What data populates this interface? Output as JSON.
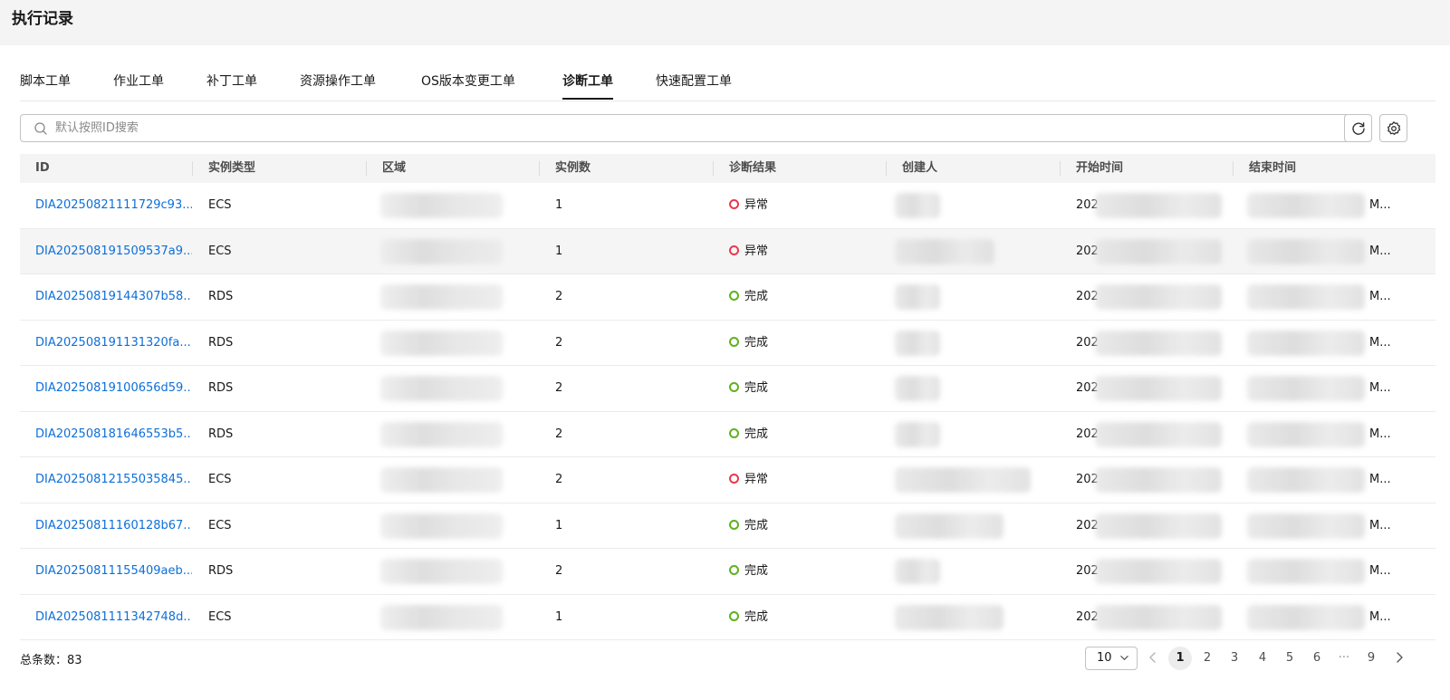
{
  "header": {
    "title": "执行记录"
  },
  "tabs": [
    {
      "label": "脚本工单"
    },
    {
      "label": "作业工单"
    },
    {
      "label": "补丁工单"
    },
    {
      "label": "资源操作工单"
    },
    {
      "label": "OS版本变更工单"
    },
    {
      "label": "诊断工单",
      "active": true
    },
    {
      "label": "快速配置工单"
    }
  ],
  "search": {
    "placeholder": "默认按照ID搜索",
    "value": ""
  },
  "table": {
    "columns": [
      "ID",
      "实例类型",
      "区域",
      "实例数",
      "诊断结果",
      "创建人",
      "开始时间",
      "结束时间"
    ],
    "rows": [
      {
        "id": "DIA20250821111729c93...",
        "type": "ECS",
        "count": "1",
        "result": "异常",
        "status": "error",
        "start": "202",
        "end": "M..."
      },
      {
        "id": "DIA202508191509537a9...",
        "type": "ECS",
        "count": "1",
        "result": "异常",
        "status": "error",
        "start": "202",
        "end": "M..."
      },
      {
        "id": "DIA20250819144307b58...",
        "type": "RDS",
        "count": "2",
        "result": "完成",
        "status": "ok",
        "start": "202",
        "end": "M..."
      },
      {
        "id": "DIA202508191131320fa...",
        "type": "RDS",
        "count": "2",
        "result": "完成",
        "status": "ok",
        "start": "202",
        "end": "M..."
      },
      {
        "id": "DIA20250819100656d59...",
        "type": "RDS",
        "count": "2",
        "result": "完成",
        "status": "ok",
        "start": "202",
        "end": "M..."
      },
      {
        "id": "DIA202508181646553b5...",
        "type": "RDS",
        "count": "2",
        "result": "完成",
        "status": "ok",
        "start": "202",
        "end": "M..."
      },
      {
        "id": "DIA20250812155035845...",
        "type": "ECS",
        "count": "2",
        "result": "异常",
        "status": "error",
        "start": "202",
        "end": "M..."
      },
      {
        "id": "DIA20250811160128b67...",
        "type": "ECS",
        "count": "1",
        "result": "完成",
        "status": "ok",
        "start": "202",
        "end": "M..."
      },
      {
        "id": "DIA20250811155409aeb...",
        "type": "RDS",
        "count": "2",
        "result": "完成",
        "status": "ok",
        "start": "202",
        "end": "M..."
      },
      {
        "id": "DIA2025081111342748d...",
        "type": "ECS",
        "count": "1",
        "result": "完成",
        "status": "ok",
        "start": "202",
        "end": "M..."
      }
    ]
  },
  "footer": {
    "total_label": "总条数：83",
    "page_size": "10",
    "pages": [
      "1",
      "2",
      "3",
      "4",
      "5",
      "6",
      "···",
      "9"
    ],
    "current_page": "1"
  },
  "colors": {
    "link": "#0d6fd9",
    "error": "#e8394e",
    "ok": "#5fb21f"
  }
}
